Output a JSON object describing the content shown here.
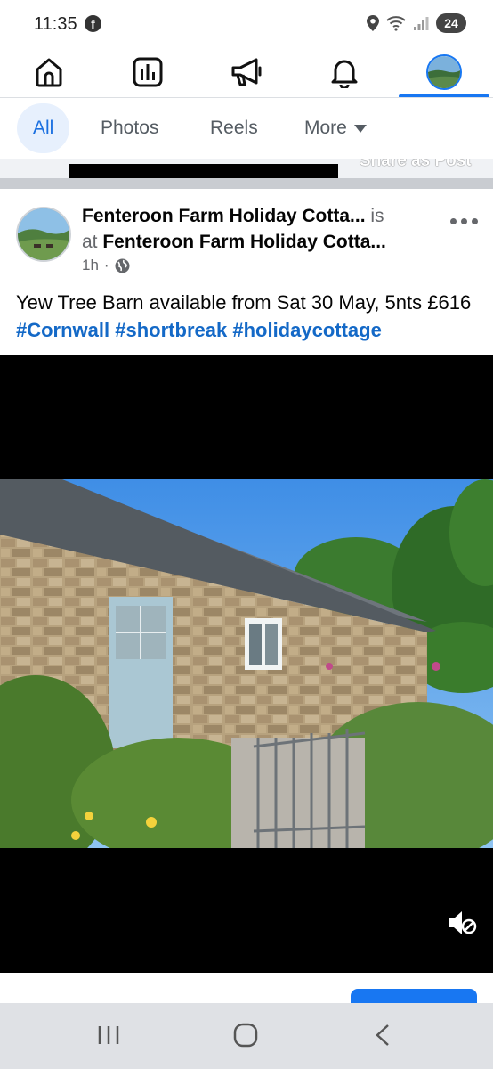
{
  "status_bar": {
    "time": "11:35",
    "facebook_badge": "f",
    "battery": "24",
    "icons": [
      "facebook-icon",
      "location-icon",
      "wifi-icon",
      "signal-icon",
      "battery-icon"
    ]
  },
  "top_nav": {
    "items": [
      "home-icon",
      "dashboard-icon",
      "megaphone-icon",
      "bell-icon",
      "profile-avatar"
    ],
    "active_index": 4,
    "accent_color": "#1877f2"
  },
  "filter_tabs": {
    "items": [
      "All",
      "Photos",
      "Reels",
      "More"
    ],
    "active": "All"
  },
  "previous_post": {
    "share_label": "Share as Post"
  },
  "post": {
    "author": "Fenteroon Farm Holiday Cotta...",
    "is_at": "is",
    "at_word": "at",
    "location": "Fenteroon Farm Holiday Cotta...",
    "time": "1h",
    "separator": "·",
    "audience_icon": "globe-icon",
    "text_plain": "Yew Tree Barn available from Sat 30 May, 5nts £616",
    "hashtags": [
      "#Cornwall",
      "#shortbreak",
      "#holidaycottage"
    ],
    "hashtag_color": "#1469c7",
    "media_icon": "mute-icon"
  },
  "android_nav": {
    "items": [
      "recent-apps-icon",
      "home-circle-icon",
      "back-icon"
    ]
  }
}
